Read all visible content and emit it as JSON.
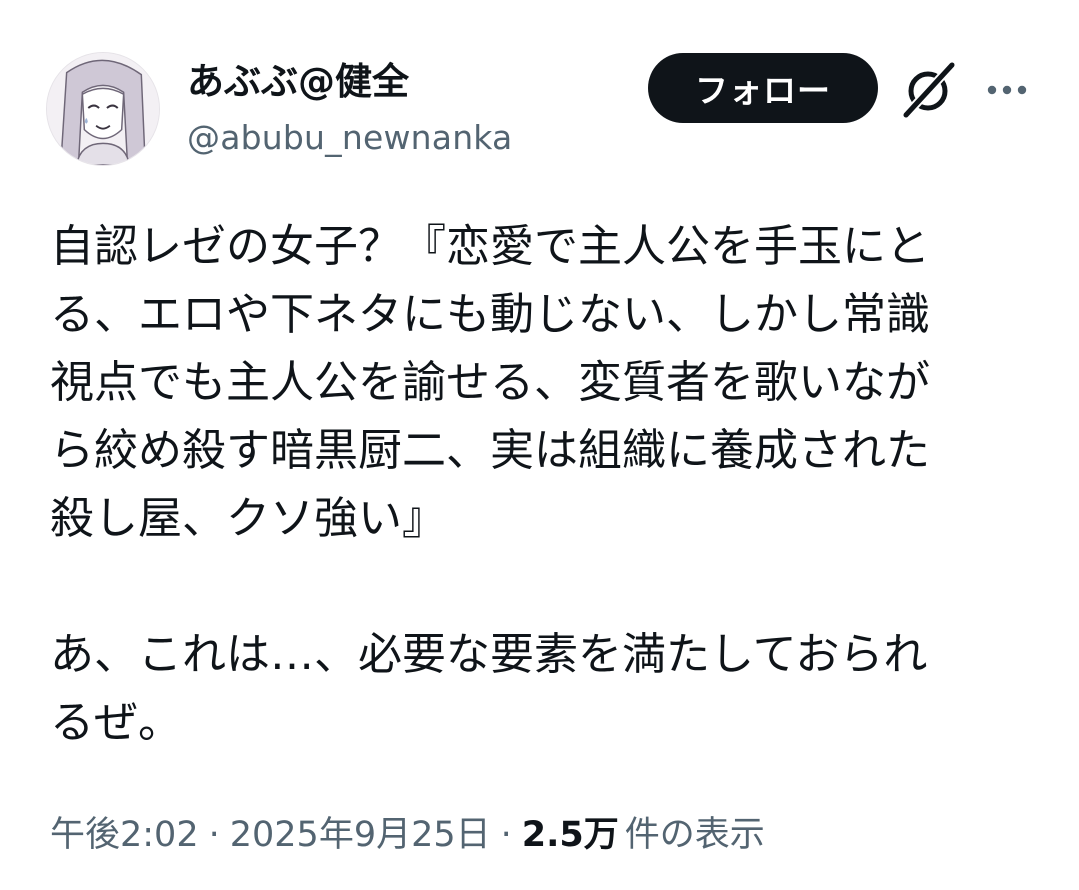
{
  "user": {
    "display_name": "あぶぶ@健全",
    "handle": "@abubu_newnanka"
  },
  "actions": {
    "follow_label": "フォロー",
    "grok_icon": "grok-icon",
    "more_icon": "more-icon"
  },
  "tweet": {
    "lines": [
      "自認レゼの女子？『恋愛で主人公を手玉にと",
      "る、エロや下ネタにも動じない、しかし常識",
      "視点でも主人公を諭せる、変質者を歌いなが",
      "ら絞め殺す暗黒厨二、実は組織に養成された",
      "殺し屋、クソ強い』",
      "",
      "あ、これは…、必要な要素を満たしておられ",
      "るぜ。"
    ]
  },
  "meta": {
    "time": "午後2:02",
    "separator": "·",
    "date": "2025年9月25日",
    "views_count": "2.5万",
    "views_label": "件の表示"
  },
  "colors": {
    "text_primary": "#0f1419",
    "text_secondary": "#536471",
    "button_bg": "#0f1419",
    "button_text": "#ffffff"
  }
}
